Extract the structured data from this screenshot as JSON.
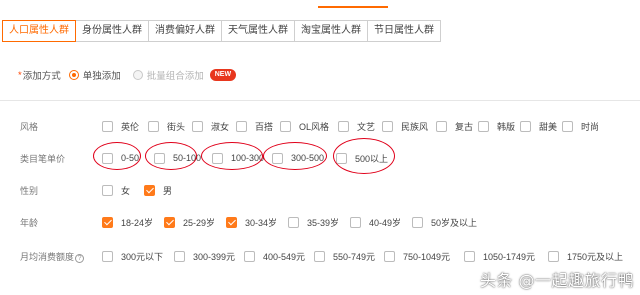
{
  "tabs": [
    {
      "label": "人口属性人群",
      "active": true
    },
    {
      "label": "身份属性人群",
      "active": false
    },
    {
      "label": "消费偏好人群",
      "active": false
    },
    {
      "label": "天气属性人群",
      "active": false
    },
    {
      "label": "淘宝属性人群",
      "active": false
    },
    {
      "label": "节日属性人群",
      "active": false
    }
  ],
  "add_mode": {
    "required_mark": "*",
    "label": "添加方式",
    "options": [
      {
        "label": "单独添加",
        "selected": true,
        "disabled": false
      },
      {
        "label": "批量组合添加",
        "selected": false,
        "disabled": true
      }
    ],
    "badge": "NEW"
  },
  "filters": [
    {
      "label": "风格",
      "options": [
        {
          "label": "英伦",
          "checked": false
        },
        {
          "label": "街头",
          "checked": false
        },
        {
          "label": "淑女",
          "checked": false
        },
        {
          "label": "百搭",
          "checked": false
        },
        {
          "label": "OL风格",
          "checked": false
        },
        {
          "label": "文艺",
          "checked": false
        },
        {
          "label": "民族风",
          "checked": false
        },
        {
          "label": "复古",
          "checked": false
        },
        {
          "label": "韩版",
          "checked": false
        },
        {
          "label": "甜美",
          "checked": false
        },
        {
          "label": "时尚",
          "checked": false
        }
      ]
    },
    {
      "label": "类目笔单价",
      "options": [
        {
          "label": "0-50",
          "checked": false
        },
        {
          "label": "50-100",
          "checked": false
        },
        {
          "label": "100-300",
          "checked": false
        },
        {
          "label": "300-500",
          "checked": false
        },
        {
          "label": "500以上",
          "checked": false
        }
      ]
    },
    {
      "label": "性别",
      "options": [
        {
          "label": "女",
          "checked": false
        },
        {
          "label": "男",
          "checked": true
        }
      ]
    },
    {
      "label": "年龄",
      "options": [
        {
          "label": "18-24岁",
          "checked": true
        },
        {
          "label": "25-29岁",
          "checked": true
        },
        {
          "label": "30-34岁",
          "checked": true
        },
        {
          "label": "35-39岁",
          "checked": false
        },
        {
          "label": "40-49岁",
          "checked": false
        },
        {
          "label": "50岁及以上",
          "checked": false
        }
      ]
    },
    {
      "label": "月均消费额度",
      "help_icon": "?",
      "options": [
        {
          "label": "300元以下",
          "checked": false
        },
        {
          "label": "300-399元",
          "checked": false
        },
        {
          "label": "400-549元",
          "checked": false
        },
        {
          "label": "550-749元",
          "checked": false
        },
        {
          "label": "750-1049元",
          "checked": false
        },
        {
          "label": "1050-1749元",
          "checked": false
        },
        {
          "label": "1750元及以上",
          "checked": false
        }
      ]
    }
  ],
  "watermark": "头条 @一起趣旅行鸭",
  "colors": {
    "accent": "#ff6a00",
    "checked": "#ff7a1a",
    "annotation": "#e0001a",
    "badge": "#e8371e"
  }
}
